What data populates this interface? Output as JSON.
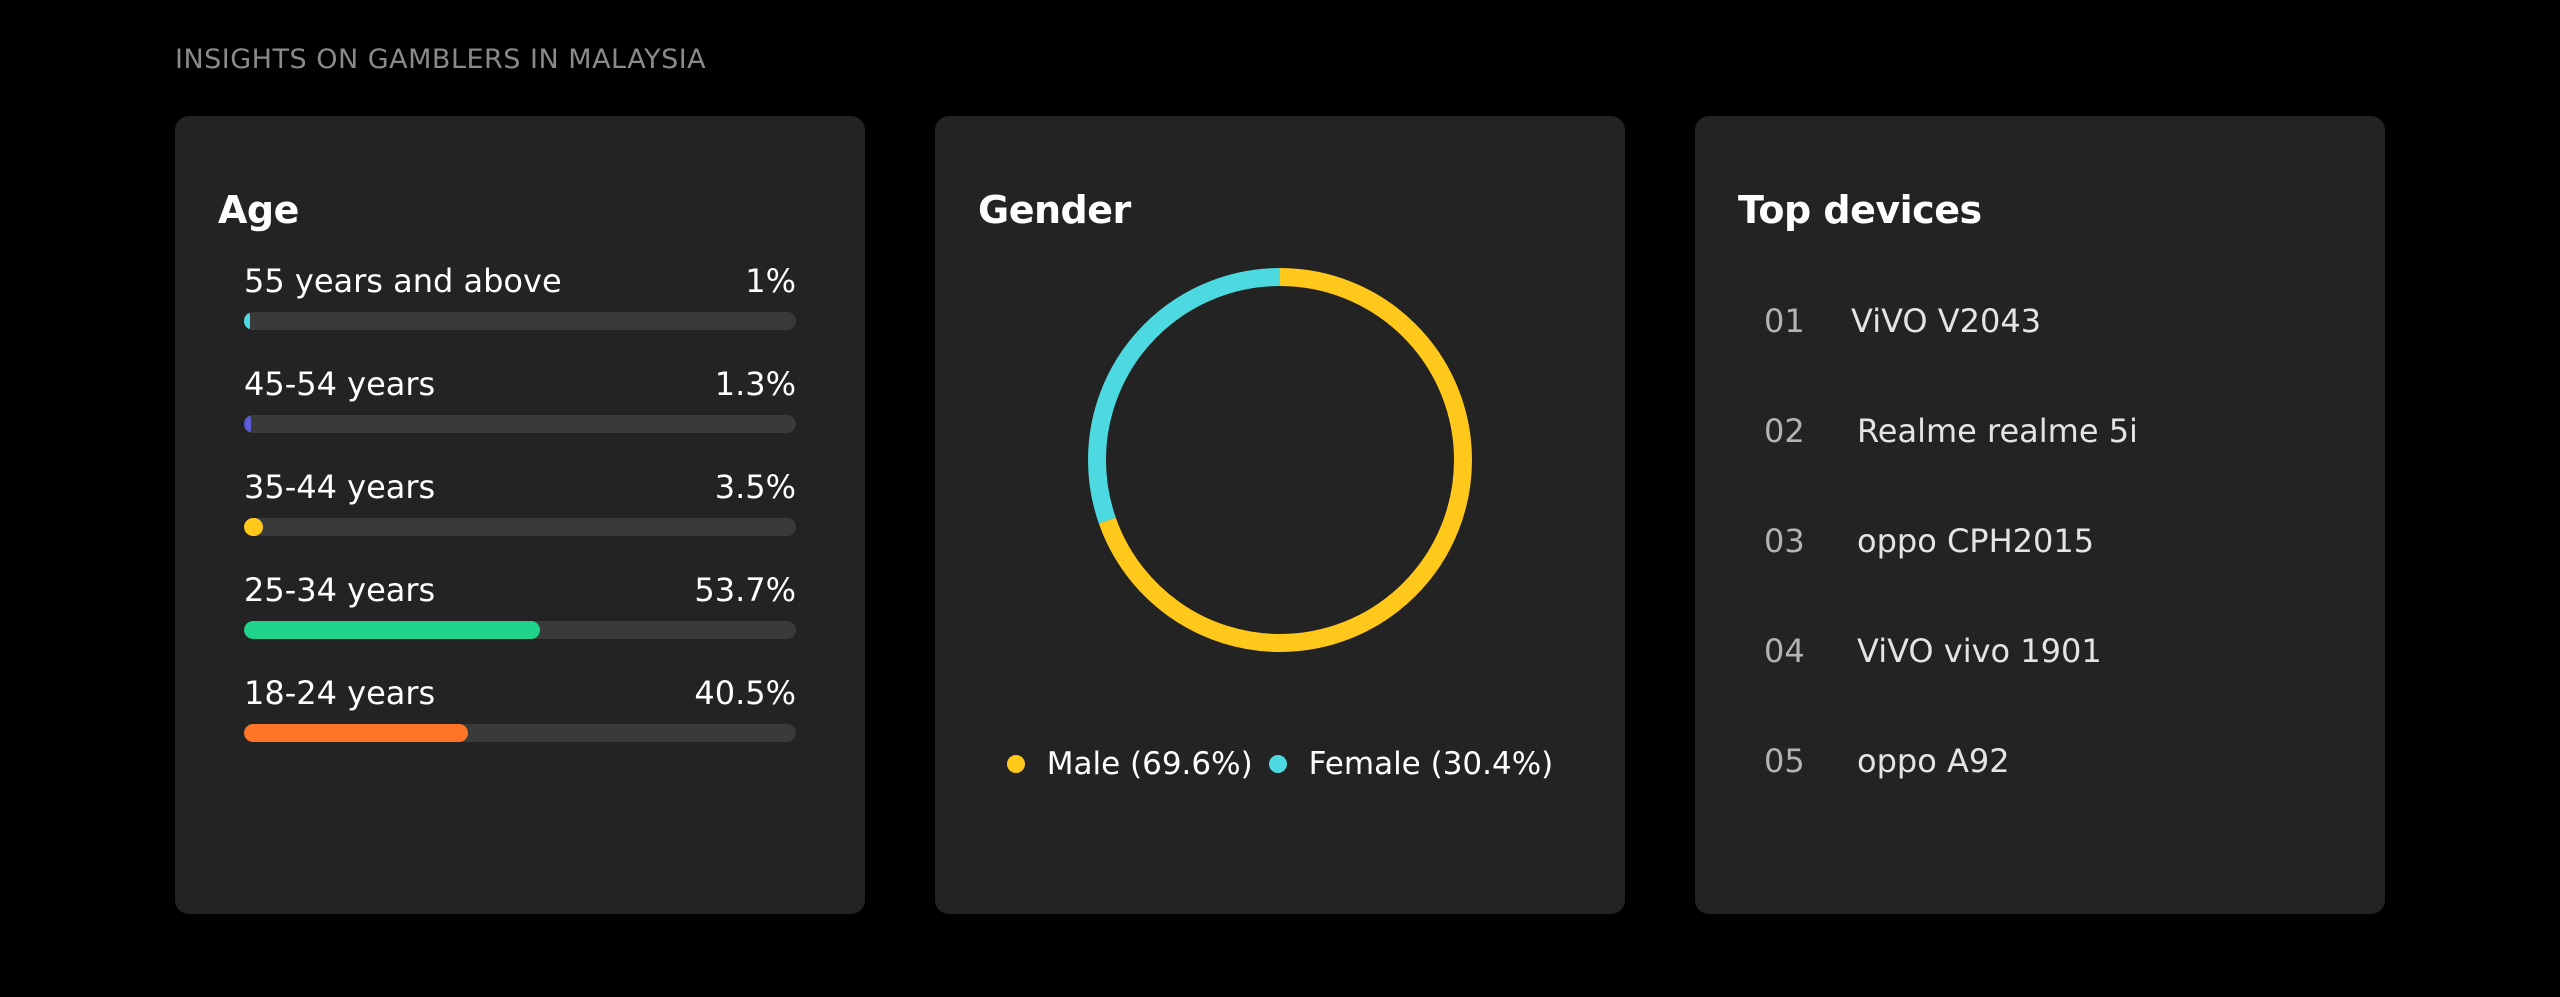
{
  "page": {
    "heading": "INSIGHTS ON GAMBLERS IN MALAYSIA"
  },
  "age_card": {
    "title": "Age",
    "rows": [
      {
        "label": "55 years and above",
        "value": "1%",
        "fraction": 0.01,
        "color": "#4dd9e0"
      },
      {
        "label": "45-54 years",
        "value": "1.3%",
        "fraction": 0.013,
        "color": "#5b5bd6"
      },
      {
        "label": "35-44 years",
        "value": "3.5%",
        "fraction": 0.035,
        "color": "#ffc81a"
      },
      {
        "label": "25-34 years",
        "value": "53.7%",
        "fraction": 0.537,
        "color": "#1fd38a"
      },
      {
        "label": "18-24 years",
        "value": "40.5%",
        "fraction": 0.405,
        "color": "#ff7426"
      }
    ]
  },
  "gender_card": {
    "title": "Gender",
    "legend": [
      {
        "label": "Male (69.6%)",
        "fraction": 0.696,
        "color": "#ffc81a"
      },
      {
        "label": "Female (30.4%)",
        "fraction": 0.304,
        "color": "#4dd9e0"
      }
    ]
  },
  "devices_card": {
    "title": "Top devices",
    "items": [
      {
        "rank": "01",
        "name": "ViVO V2043"
      },
      {
        "rank": "02",
        "name": "Realme realme 5i"
      },
      {
        "rank": "03",
        "name": "oppo CPH2015"
      },
      {
        "rank": "04",
        "name": "ViVO vivo 1901"
      },
      {
        "rank": "05",
        "name": "oppo A92"
      }
    ]
  },
  "colors": {
    "background": "#000000",
    "card": "#232323",
    "track": "#3a3a3a"
  }
}
